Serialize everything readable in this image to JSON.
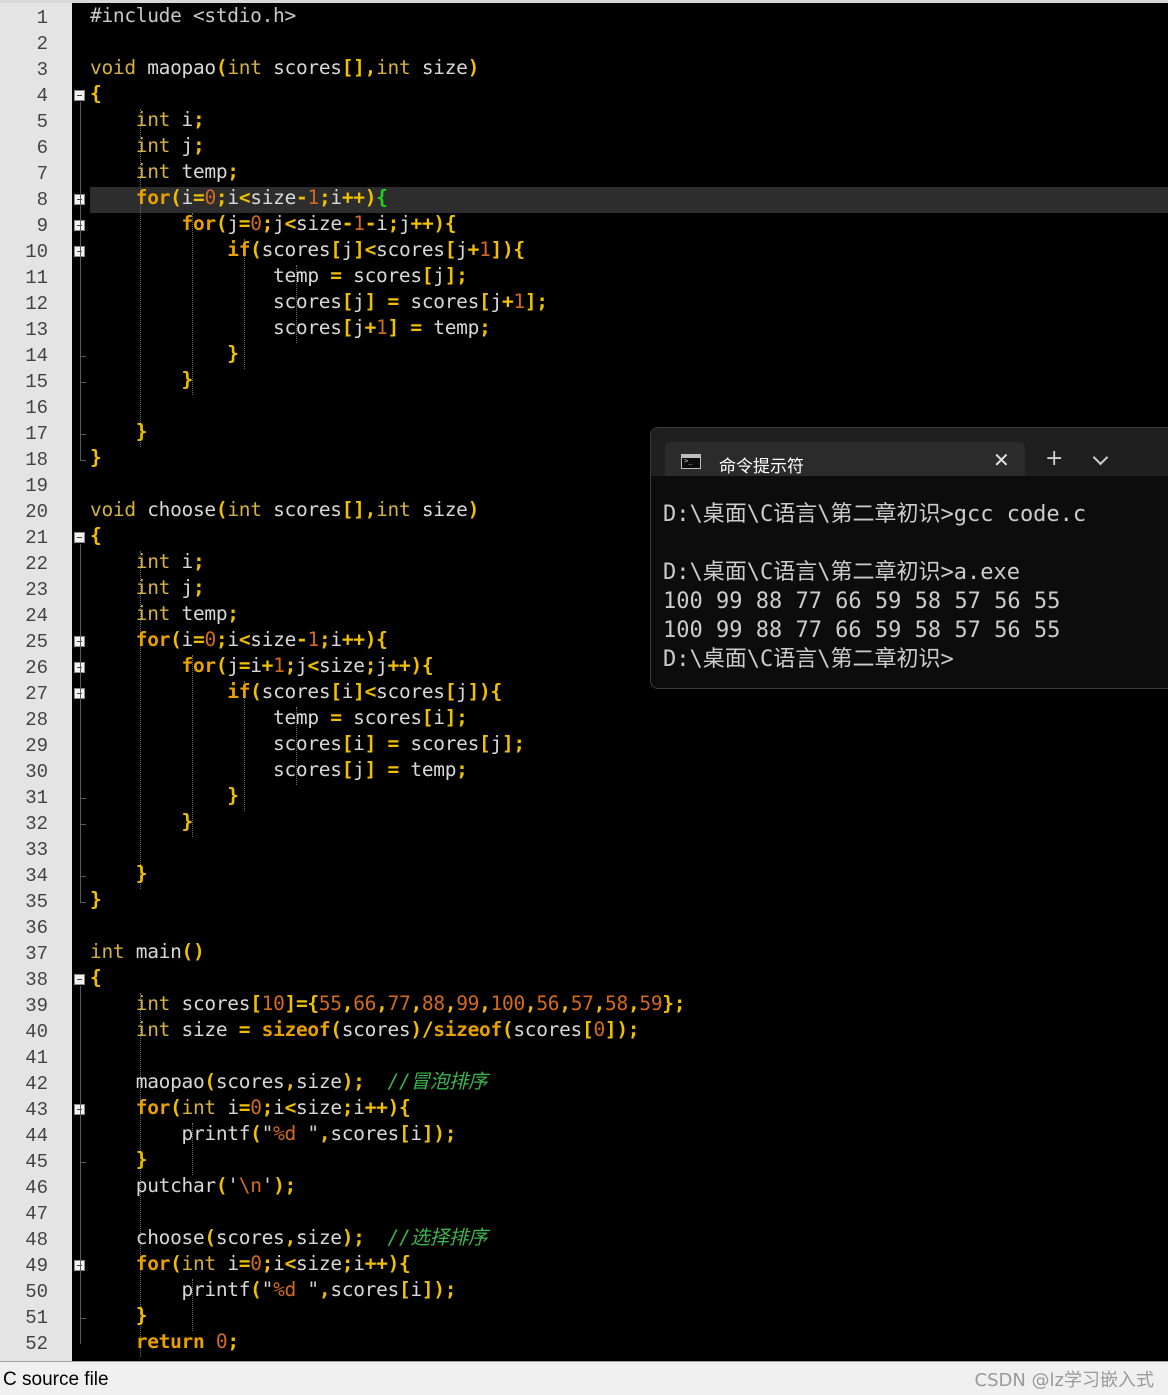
{
  "editor": {
    "line_numbers": [
      "1",
      "2",
      "3",
      "4",
      "5",
      "6",
      "7",
      "8",
      "9",
      "10",
      "11",
      "12",
      "13",
      "14",
      "15",
      "16",
      "17",
      "18",
      "19",
      "20",
      "21",
      "22",
      "23",
      "24",
      "25",
      "26",
      "27",
      "28",
      "29",
      "30",
      "31",
      "32",
      "33",
      "34",
      "35",
      "36",
      "37",
      "38",
      "39",
      "40",
      "41",
      "42",
      "43",
      "44",
      "45",
      "46",
      "47",
      "48",
      "49",
      "50",
      "51",
      "52"
    ],
    "current_line": 8,
    "code": [
      [
        [
          "pp",
          "#include <stdio.h>"
        ]
      ],
      [],
      [
        [
          "vo",
          "void"
        ],
        [
          "id",
          " maopao"
        ],
        [
          "op",
          "("
        ],
        [
          "ty",
          "int"
        ],
        [
          "id",
          " scores"
        ],
        [
          "op",
          "[],"
        ],
        [
          "ty",
          "int"
        ],
        [
          "id",
          " size"
        ],
        [
          "op",
          ")"
        ]
      ],
      [
        [
          "op",
          "{"
        ]
      ],
      [
        [
          "id",
          "    "
        ],
        [
          "ty",
          "int"
        ],
        [
          "id",
          " i"
        ],
        [
          "op",
          ";"
        ]
      ],
      [
        [
          "id",
          "    "
        ],
        [
          "ty",
          "int"
        ],
        [
          "id",
          " j"
        ],
        [
          "op",
          ";"
        ]
      ],
      [
        [
          "id",
          "    "
        ],
        [
          "ty",
          "int"
        ],
        [
          "id",
          " temp"
        ],
        [
          "op",
          ";"
        ]
      ],
      [
        [
          "id",
          "    "
        ],
        [
          "kw",
          "for"
        ],
        [
          "op",
          "("
        ],
        [
          "id",
          "i"
        ],
        [
          "op",
          "="
        ],
        [
          "num",
          "0"
        ],
        [
          "op",
          ";"
        ],
        [
          "id",
          "i"
        ],
        [
          "op",
          "<"
        ],
        [
          "id",
          "size"
        ],
        [
          "op",
          "-"
        ],
        [
          "num",
          "1"
        ],
        [
          "op",
          ";"
        ],
        [
          "id",
          "i"
        ],
        [
          "op",
          "++)"
        ],
        [
          "gbr",
          "{"
        ]
      ],
      [
        [
          "id",
          "        "
        ],
        [
          "kw",
          "for"
        ],
        [
          "op",
          "("
        ],
        [
          "id",
          "j"
        ],
        [
          "op",
          "="
        ],
        [
          "num",
          "0"
        ],
        [
          "op",
          ";"
        ],
        [
          "id",
          "j"
        ],
        [
          "op",
          "<"
        ],
        [
          "id",
          "size"
        ],
        [
          "op",
          "-"
        ],
        [
          "num",
          "1"
        ],
        [
          "op",
          "-"
        ],
        [
          "id",
          "i"
        ],
        [
          "op",
          ";"
        ],
        [
          "id",
          "j"
        ],
        [
          "op",
          "++){"
        ]
      ],
      [
        [
          "id",
          "            "
        ],
        [
          "kw",
          "if"
        ],
        [
          "op",
          "("
        ],
        [
          "id",
          "scores"
        ],
        [
          "op",
          "["
        ],
        [
          "id",
          "j"
        ],
        [
          "op",
          "]<"
        ],
        [
          "id",
          "scores"
        ],
        [
          "op",
          "["
        ],
        [
          "id",
          "j"
        ],
        [
          "op",
          "+"
        ],
        [
          "num",
          "1"
        ],
        [
          "op",
          "]){"
        ]
      ],
      [
        [
          "id",
          "                temp "
        ],
        [
          "op",
          "="
        ],
        [
          "id",
          " scores"
        ],
        [
          "op",
          "["
        ],
        [
          "id",
          "j"
        ],
        [
          "op",
          "];"
        ]
      ],
      [
        [
          "id",
          "                scores"
        ],
        [
          "op",
          "["
        ],
        [
          "id",
          "j"
        ],
        [
          "op",
          "]"
        ],
        [
          "id",
          " "
        ],
        [
          "op",
          "="
        ],
        [
          "id",
          " scores"
        ],
        [
          "op",
          "["
        ],
        [
          "id",
          "j"
        ],
        [
          "op",
          "+"
        ],
        [
          "num",
          "1"
        ],
        [
          "op",
          "];"
        ]
      ],
      [
        [
          "id",
          "                scores"
        ],
        [
          "op",
          "["
        ],
        [
          "id",
          "j"
        ],
        [
          "op",
          "+"
        ],
        [
          "num",
          "1"
        ],
        [
          "op",
          "]"
        ],
        [
          "id",
          " "
        ],
        [
          "op",
          "="
        ],
        [
          "id",
          " temp"
        ],
        [
          "op",
          ";"
        ]
      ],
      [
        [
          "id",
          "            "
        ],
        [
          "op",
          "}"
        ]
      ],
      [
        [
          "id",
          "        "
        ],
        [
          "op",
          "}"
        ]
      ],
      [],
      [
        [
          "id",
          "    "
        ],
        [
          "op",
          "}"
        ]
      ],
      [
        [
          "op",
          "}"
        ]
      ],
      [],
      [
        [
          "vo",
          "void"
        ],
        [
          "id",
          " choose"
        ],
        [
          "op",
          "("
        ],
        [
          "ty",
          "int"
        ],
        [
          "id",
          " scores"
        ],
        [
          "op",
          "[],"
        ],
        [
          "ty",
          "int"
        ],
        [
          "id",
          " size"
        ],
        [
          "op",
          ")"
        ]
      ],
      [
        [
          "op",
          "{"
        ]
      ],
      [
        [
          "id",
          "    "
        ],
        [
          "ty",
          "int"
        ],
        [
          "id",
          " i"
        ],
        [
          "op",
          ";"
        ]
      ],
      [
        [
          "id",
          "    "
        ],
        [
          "ty",
          "int"
        ],
        [
          "id",
          " j"
        ],
        [
          "op",
          ";"
        ]
      ],
      [
        [
          "id",
          "    "
        ],
        [
          "ty",
          "int"
        ],
        [
          "id",
          " temp"
        ],
        [
          "op",
          ";"
        ]
      ],
      [
        [
          "id",
          "    "
        ],
        [
          "kw",
          "for"
        ],
        [
          "op",
          "("
        ],
        [
          "id",
          "i"
        ],
        [
          "op",
          "="
        ],
        [
          "num",
          "0"
        ],
        [
          "op",
          ";"
        ],
        [
          "id",
          "i"
        ],
        [
          "op",
          "<"
        ],
        [
          "id",
          "size"
        ],
        [
          "op",
          "-"
        ],
        [
          "num",
          "1"
        ],
        [
          "op",
          ";"
        ],
        [
          "id",
          "i"
        ],
        [
          "op",
          "++){"
        ]
      ],
      [
        [
          "id",
          "        "
        ],
        [
          "kw",
          "for"
        ],
        [
          "op",
          "("
        ],
        [
          "id",
          "j"
        ],
        [
          "op",
          "="
        ],
        [
          "id",
          "i"
        ],
        [
          "op",
          "+"
        ],
        [
          "num",
          "1"
        ],
        [
          "op",
          ";"
        ],
        [
          "id",
          "j"
        ],
        [
          "op",
          "<"
        ],
        [
          "id",
          "size"
        ],
        [
          "op",
          ";"
        ],
        [
          "id",
          "j"
        ],
        [
          "op",
          "++){"
        ]
      ],
      [
        [
          "id",
          "            "
        ],
        [
          "kw",
          "if"
        ],
        [
          "op",
          "("
        ],
        [
          "id",
          "scores"
        ],
        [
          "op",
          "["
        ],
        [
          "id",
          "i"
        ],
        [
          "op",
          "]<"
        ],
        [
          "id",
          "scores"
        ],
        [
          "op",
          "["
        ],
        [
          "id",
          "j"
        ],
        [
          "op",
          "]){"
        ]
      ],
      [
        [
          "id",
          "                temp "
        ],
        [
          "op",
          "="
        ],
        [
          "id",
          " scores"
        ],
        [
          "op",
          "["
        ],
        [
          "id",
          "i"
        ],
        [
          "op",
          "];"
        ]
      ],
      [
        [
          "id",
          "                scores"
        ],
        [
          "op",
          "["
        ],
        [
          "id",
          "i"
        ],
        [
          "op",
          "]"
        ],
        [
          "id",
          " "
        ],
        [
          "op",
          "="
        ],
        [
          "id",
          " scores"
        ],
        [
          "op",
          "["
        ],
        [
          "id",
          "j"
        ],
        [
          "op",
          "];"
        ]
      ],
      [
        [
          "id",
          "                scores"
        ],
        [
          "op",
          "["
        ],
        [
          "id",
          "j"
        ],
        [
          "op",
          "]"
        ],
        [
          "id",
          " "
        ],
        [
          "op",
          "="
        ],
        [
          "id",
          " temp"
        ],
        [
          "op",
          ";"
        ]
      ],
      [
        [
          "id",
          "            "
        ],
        [
          "op",
          "}"
        ]
      ],
      [
        [
          "id",
          "        "
        ],
        [
          "op",
          "}"
        ]
      ],
      [],
      [
        [
          "id",
          "    "
        ],
        [
          "op",
          "}"
        ]
      ],
      [
        [
          "op",
          "}"
        ]
      ],
      [],
      [
        [
          "ty",
          "int"
        ],
        [
          "id",
          " main"
        ],
        [
          "op",
          "()"
        ]
      ],
      [
        [
          "op",
          "{"
        ]
      ],
      [
        [
          "id",
          "    "
        ],
        [
          "ty",
          "int"
        ],
        [
          "id",
          " scores"
        ],
        [
          "op",
          "["
        ],
        [
          "num",
          "10"
        ],
        [
          "op",
          "]={"
        ],
        [
          "num",
          "55"
        ],
        [
          "op",
          ","
        ],
        [
          "num",
          "66"
        ],
        [
          "op",
          ","
        ],
        [
          "num",
          "77"
        ],
        [
          "op",
          ","
        ],
        [
          "num",
          "88"
        ],
        [
          "op",
          ","
        ],
        [
          "num",
          "99"
        ],
        [
          "op",
          ","
        ],
        [
          "num",
          "100"
        ],
        [
          "op",
          ","
        ],
        [
          "num",
          "56"
        ],
        [
          "op",
          ","
        ],
        [
          "num",
          "57"
        ],
        [
          "op",
          ","
        ],
        [
          "num",
          "58"
        ],
        [
          "op",
          ","
        ],
        [
          "num",
          "59"
        ],
        [
          "op",
          "};"
        ]
      ],
      [
        [
          "id",
          "    "
        ],
        [
          "ty",
          "int"
        ],
        [
          "id",
          " size "
        ],
        [
          "op",
          "="
        ],
        [
          "id",
          " "
        ],
        [
          "kw",
          "sizeof"
        ],
        [
          "op",
          "("
        ],
        [
          "id",
          "scores"
        ],
        [
          "op",
          ")/"
        ],
        [
          "kw",
          "sizeof"
        ],
        [
          "op",
          "("
        ],
        [
          "id",
          "scores"
        ],
        [
          "op",
          "["
        ],
        [
          "num",
          "0"
        ],
        [
          "op",
          "]);"
        ]
      ],
      [],
      [
        [
          "id",
          "    maopao"
        ],
        [
          "op",
          "("
        ],
        [
          "id",
          "scores"
        ],
        [
          "op",
          ","
        ],
        [
          "id",
          "size"
        ],
        [
          "op",
          ");"
        ],
        [
          "id",
          "  "
        ],
        [
          "cm",
          "//冒泡排序"
        ]
      ],
      [
        [
          "id",
          "    "
        ],
        [
          "kw",
          "for"
        ],
        [
          "op",
          "("
        ],
        [
          "ty",
          "int"
        ],
        [
          "id",
          " i"
        ],
        [
          "op",
          "="
        ],
        [
          "num",
          "0"
        ],
        [
          "op",
          ";"
        ],
        [
          "id",
          "i"
        ],
        [
          "op",
          "<"
        ],
        [
          "id",
          "size"
        ],
        [
          "op",
          ";"
        ],
        [
          "id",
          "i"
        ],
        [
          "op",
          "++){"
        ]
      ],
      [
        [
          "id",
          "        printf"
        ],
        [
          "op",
          "("
        ],
        [
          "str",
          "\""
        ],
        [
          "fmt",
          "%d"
        ],
        [
          "str",
          " \""
        ],
        [
          "op",
          ","
        ],
        [
          "id",
          "scores"
        ],
        [
          "op",
          "["
        ],
        [
          "id",
          "i"
        ],
        [
          "op",
          "]);"
        ]
      ],
      [
        [
          "id",
          "    "
        ],
        [
          "op",
          "}"
        ]
      ],
      [
        [
          "id",
          "    putchar"
        ],
        [
          "op",
          "("
        ],
        [
          "str",
          "'"
        ],
        [
          "fmt",
          "\\n"
        ],
        [
          "str",
          "'"
        ],
        [
          "op",
          ");"
        ]
      ],
      [],
      [
        [
          "id",
          "    choose"
        ],
        [
          "op",
          "("
        ],
        [
          "id",
          "scores"
        ],
        [
          "op",
          ","
        ],
        [
          "id",
          "size"
        ],
        [
          "op",
          ");"
        ],
        [
          "id",
          "  "
        ],
        [
          "cm",
          "//选择排序"
        ]
      ],
      [
        [
          "id",
          "    "
        ],
        [
          "kw",
          "for"
        ],
        [
          "op",
          "("
        ],
        [
          "ty",
          "int"
        ],
        [
          "id",
          " i"
        ],
        [
          "op",
          "="
        ],
        [
          "num",
          "0"
        ],
        [
          "op",
          ";"
        ],
        [
          "id",
          "i"
        ],
        [
          "op",
          "<"
        ],
        [
          "id",
          "size"
        ],
        [
          "op",
          ";"
        ],
        [
          "id",
          "i"
        ],
        [
          "op",
          "++){"
        ]
      ],
      [
        [
          "id",
          "        printf"
        ],
        [
          "op",
          "("
        ],
        [
          "str",
          "\""
        ],
        [
          "fmt",
          "%d"
        ],
        [
          "str",
          " \""
        ],
        [
          "op",
          ","
        ],
        [
          "id",
          "scores"
        ],
        [
          "op",
          "["
        ],
        [
          "id",
          "i"
        ],
        [
          "op",
          "]);"
        ]
      ],
      [
        [
          "id",
          "    "
        ],
        [
          "op",
          "}"
        ]
      ],
      [
        [
          "id",
          "    "
        ],
        [
          "kw",
          "return"
        ],
        [
          "id",
          " "
        ],
        [
          "num",
          "0"
        ],
        [
          "op",
          ";"
        ]
      ]
    ]
  },
  "terminal": {
    "tab_title": "命令提示符",
    "tab_icon": "cmd-console-icon",
    "close_glyph": "✕",
    "new_tab_glyph": "+",
    "lines": [
      "D:\\桌面\\C语言\\第二章初识>gcc code.c",
      "",
      "D:\\桌面\\C语言\\第二章初识>a.exe",
      "100 99 88 77 66 59 58 57 56 55",
      "100 99 88 77 66 59 58 57 56 55",
      "D:\\桌面\\C语言\\第二章初识>"
    ]
  },
  "status_bar": {
    "file_type": "C source file",
    "watermark": "CSDN @lz学习嵌入式"
  },
  "colors": {
    "keyword": "#e8a000",
    "type": "#d4b040",
    "number": "#d46a1e",
    "comment": "#3cb44a",
    "matched_brace": "#20d020",
    "background": "#000000",
    "gutter": "#e4e4e4"
  }
}
